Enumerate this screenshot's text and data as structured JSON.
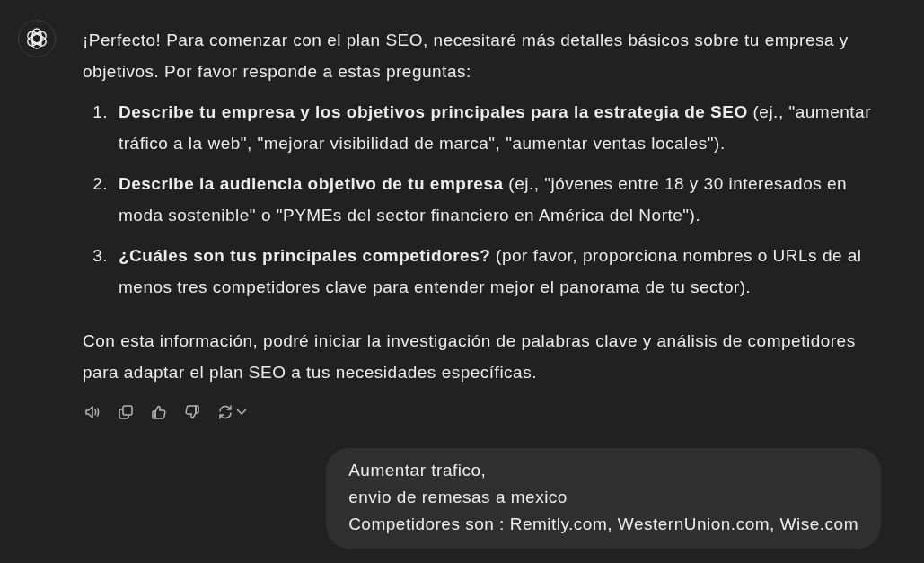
{
  "assistant_message": {
    "intro": "¡Perfecto! Para comenzar con el plan SEO, necesitaré más detalles básicos sobre tu empresa y objetivos. Por favor responde a estas preguntas:",
    "questions": [
      {
        "number": "1.",
        "text": "**Describe tu empresa y los objetivos principales para la estrategia de SEO** (ej., \"aumentar tráfico a la web\", \"mejorar visibilidad de marca\", \"aumentar ventas locales\")."
      },
      {
        "number": "2.",
        "text": "**Describe la audiencia objetivo de tu empresa** (ej., \"jóvenes entre 18 y 30 interesados en moda sostenible\" o \"PYMEs del sector financiero en América del Norte\")."
      },
      {
        "number": "3.",
        "text": "**¿Cuáles son tus principales competidores?** (por favor, proporciona nombres o URLs de al menos tres competidores clave para entender mejor el panorama de tu sector)."
      }
    ],
    "closing": "Con esta información, podré iniciar la investigación de palabras clave y análisis de competidores para adaptar el plan SEO a tus necesidades específicas.",
    "actions": [
      {
        "kind": "read_aloud"
      },
      {
        "kind": "copy"
      },
      {
        "kind": "like"
      },
      {
        "kind": "dislike"
      },
      {
        "kind": "regenerate"
      }
    ]
  },
  "user_message": {
    "text": "Aumentar trafico,\nenvio de remesas a mexico\nCompetidores son : Remitly.com, WesternUnion.com, Wise.com"
  }
}
